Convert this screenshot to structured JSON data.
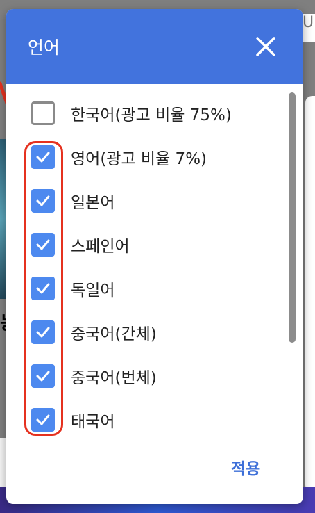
{
  "dialog": {
    "title": "언어",
    "apply_label": "적용",
    "languages": [
      {
        "label": "한국어(광고 비율 75%)",
        "checked": false
      },
      {
        "label": "영어(광고 비율 7%)",
        "checked": true
      },
      {
        "label": "일본어",
        "checked": true
      },
      {
        "label": "스페인어",
        "checked": true
      },
      {
        "label": "독일어",
        "checked": true
      },
      {
        "label": "중국어(간체)",
        "checked": true
      },
      {
        "label": "중국어(번체)",
        "checked": true
      },
      {
        "label": "태국어",
        "checked": true
      }
    ]
  },
  "background": {
    "header_fragment": "U",
    "bold_fragment": "능"
  },
  "colors": {
    "header": "#4273dd",
    "checkbox": "#4d89ef",
    "annotation": "#e5311f",
    "apply": "#3d6fd8"
  }
}
